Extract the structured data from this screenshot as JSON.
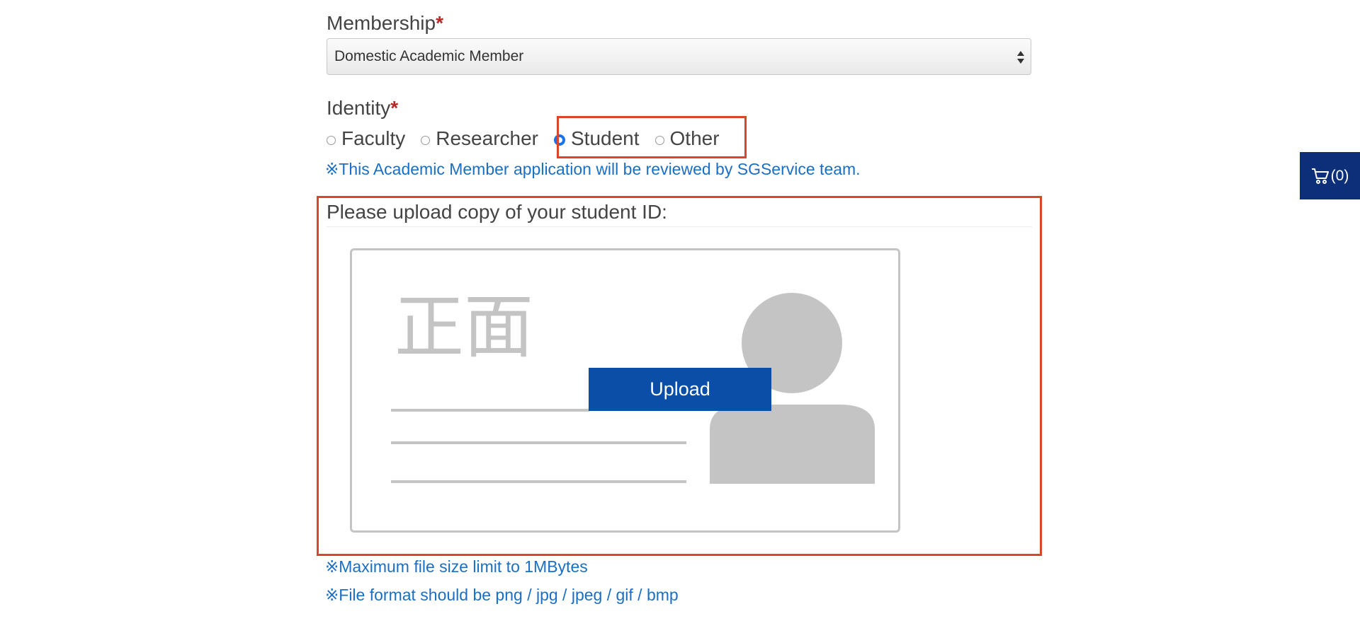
{
  "membership": {
    "label": "Membership",
    "required_mark": "*",
    "selected": "Domestic Academic Member"
  },
  "identity": {
    "label": "Identity",
    "required_mark": "*",
    "options": [
      {
        "label": "Faculty",
        "checked": false
      },
      {
        "label": "Researcher",
        "checked": false
      },
      {
        "label": "Student",
        "checked": true
      },
      {
        "label": "Other",
        "checked": false
      }
    ],
    "note": "※This Academic Member application will be reviewed by SGService team."
  },
  "upload": {
    "title": "Please upload copy of your student ID:",
    "card_text": "正面",
    "button_label": "Upload",
    "notes": [
      "※Maximum file size limit to 1MBytes",
      "※File format should be png / jpg / jpeg / gif / bmp"
    ]
  },
  "cart": {
    "icon": "cart-icon",
    "count_label": "(0)"
  },
  "colors": {
    "accent_blue": "#0b4ea8",
    "note_blue": "#1a6fc4",
    "highlight_red": "#d9472b",
    "required_red": "#b52b27",
    "cart_bg": "#0d2f7a"
  }
}
